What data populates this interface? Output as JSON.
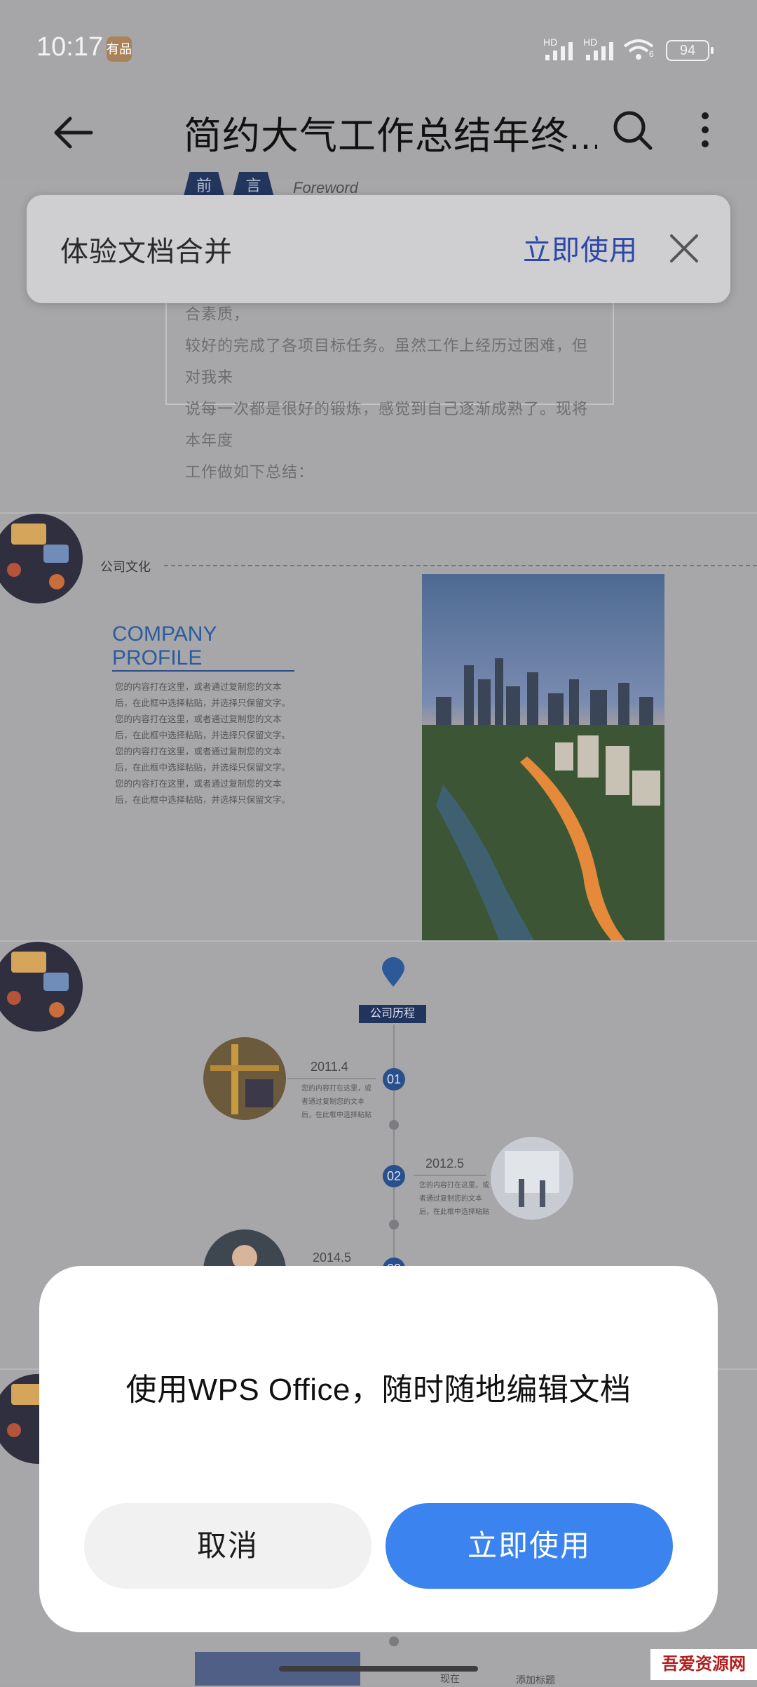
{
  "status_bar": {
    "time": "10:17",
    "badge": "有品",
    "network1": "HD",
    "network2": "HD",
    "wifi_index": "6",
    "battery": "94"
  },
  "toolbar": {
    "title": "简约大气工作总结年终...",
    "back_icon": "back-arrow-icon",
    "search_icon": "search-icon",
    "more_icon": "more-vertical-icon"
  },
  "merge_banner": {
    "text": "体验文档合并",
    "action": "立即使用",
    "close_icon": "close-icon"
  },
  "document": {
    "page1": {
      "tags": [
        "前",
        "言"
      ],
      "foreword": "Foreword",
      "paragraph_lines": [
        "职员，工作酝酿两凡备于自己的思想职权、工作能力和综合素质，",
        "较好的完成了各项目标任务。虽然工作上经历过困难，但对我来",
        "说每一次都是很好的锻炼，感觉到自己逐渐成熟了。现将本年度",
        "工作做如下总结："
      ]
    },
    "page2": {
      "section": "公司文化",
      "heading_line1": "COMPANY",
      "heading_line2": "PROFILE",
      "body": "您的内容打在这里，或者通过复制您的文本后，在此框中选择粘贴，并选择只保留文字。您的内容打在这里，或者通过复制您的文本后，在此框中选择粘贴，并选择只保留文字。您的内容打在这里，或者通过复制您的文本后，在此框中选择粘贴，并选择只保留文字。您的内容打在这里，或者通过复制您的文本后，在此框中选择粘贴，并选择只保留文字。"
    },
    "page3": {
      "section": "公司历程",
      "milestones": [
        {
          "num": "01",
          "year": "2011.4",
          "desc": "您的内容打在这里，或者通过复制您的文本后，在此框中选择粘贴"
        },
        {
          "num": "02",
          "year": "2012.5",
          "desc": "您的内容打在这里，或者通过复制您的文本后，在此框中选择粘贴"
        },
        {
          "num": "03",
          "year": "2014.5",
          "desc": ""
        }
      ]
    },
    "page4": {
      "fragment1": "现在",
      "fragment2": "添加标题"
    }
  },
  "dialog": {
    "message": "使用WPS Office，随时随地编辑文档",
    "cancel": "取消",
    "confirm": "立即使用"
  },
  "watermark": "吾爱资源网"
}
